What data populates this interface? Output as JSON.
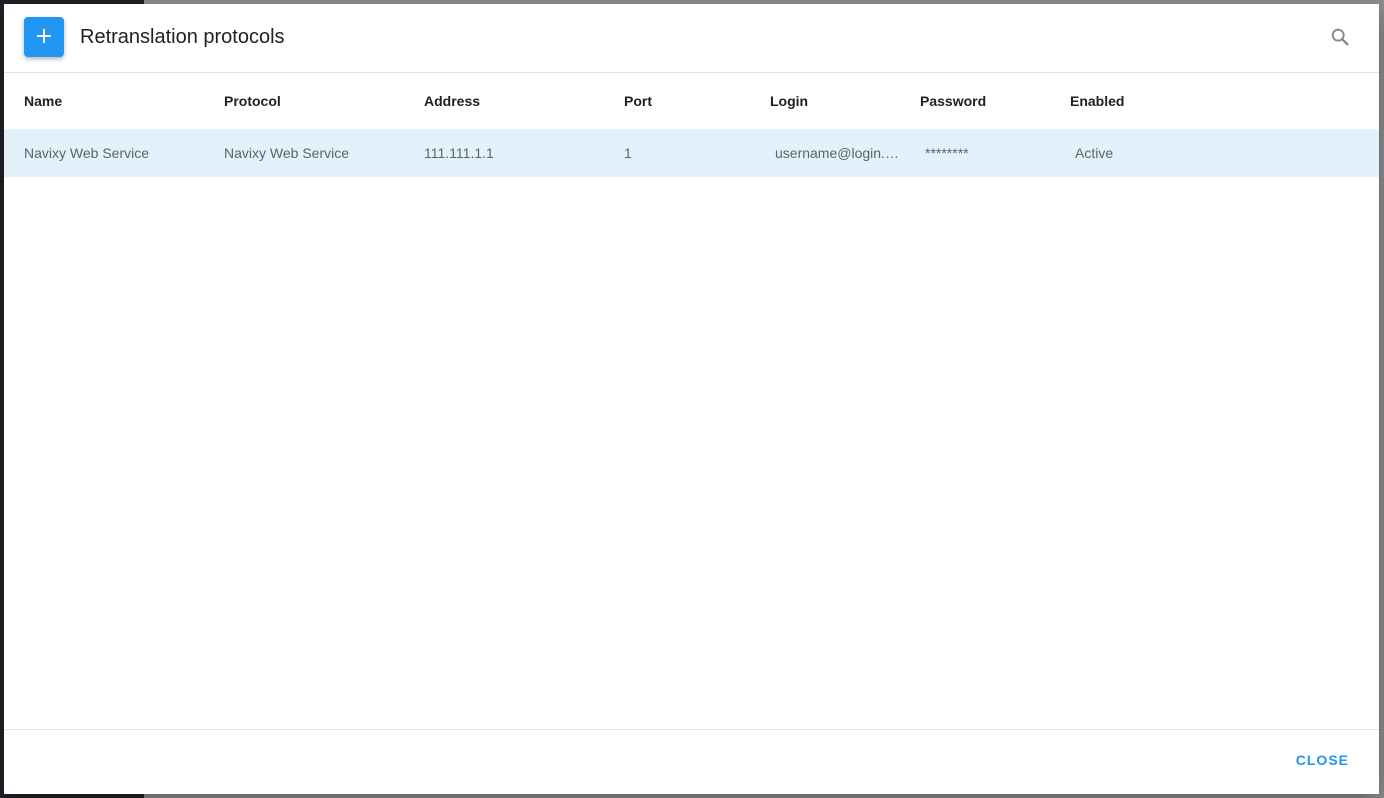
{
  "dialog": {
    "title": "Retranslation protocols",
    "add_button_label": "+",
    "search_icon": "search-icon"
  },
  "table": {
    "columns": [
      "Name",
      "Protocol",
      "Address",
      "Port",
      "Login",
      "Password",
      "Enabled"
    ],
    "rows": [
      {
        "name": "Navixy Web Service",
        "protocol": "Navixy Web Service",
        "address": "111.111.1.1",
        "port": "1",
        "login": "username@login.c...",
        "password": "********",
        "enabled": "Active"
      }
    ]
  },
  "footer": {
    "close_label": "CLOSE"
  },
  "colors": {
    "accent": "#2196f3",
    "selected_row": "#e3f1fb"
  }
}
